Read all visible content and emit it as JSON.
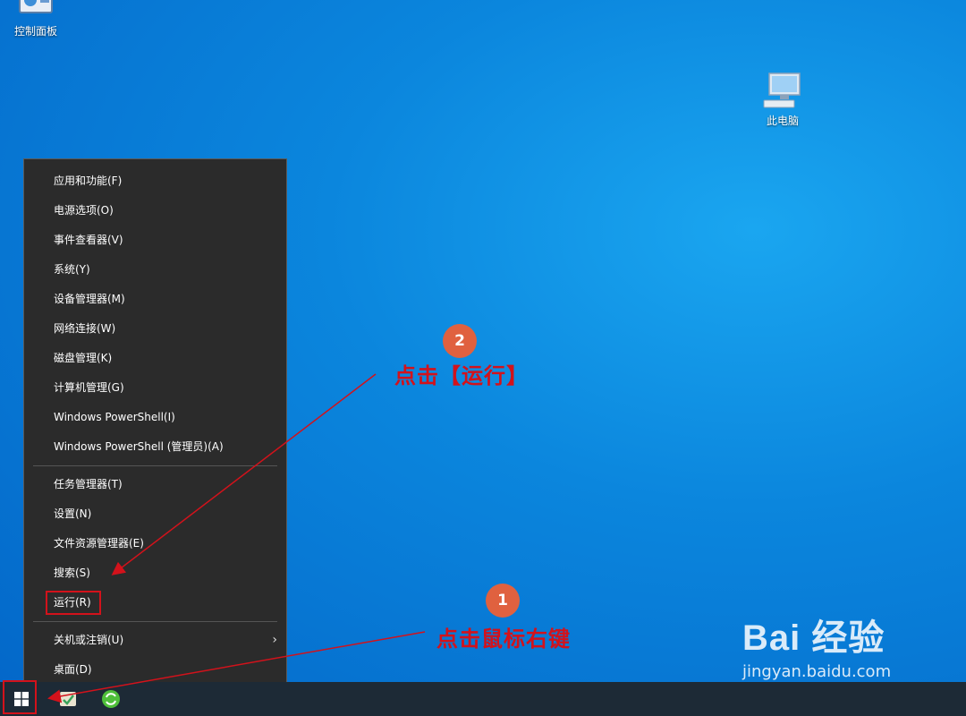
{
  "desktop": {
    "icons": [
      {
        "label": "控制面板"
      },
      {
        "label": "此电脑"
      }
    ]
  },
  "context_menu": {
    "items": [
      {
        "label": "应用和功能(F)"
      },
      {
        "label": "电源选项(O)"
      },
      {
        "label": "事件查看器(V)"
      },
      {
        "label": "系统(Y)"
      },
      {
        "label": "设备管理器(M)"
      },
      {
        "label": "网络连接(W)"
      },
      {
        "label": "磁盘管理(K)"
      },
      {
        "label": "计算机管理(G)"
      },
      {
        "label": "Windows PowerShell(I)"
      },
      {
        "label": "Windows PowerShell (管理员)(A)"
      },
      {
        "label": "任务管理器(T)"
      },
      {
        "label": "设置(N)"
      },
      {
        "label": "文件资源管理器(E)"
      },
      {
        "label": "搜索(S)"
      },
      {
        "label": "运行(R)"
      },
      {
        "label": "关机或注销(U)"
      },
      {
        "label": "桌面(D)"
      }
    ]
  },
  "annotations": {
    "step1": {
      "number": "1",
      "text": "点击鼠标右键"
    },
    "step2": {
      "number": "2",
      "text": "点击【运行】"
    }
  },
  "watermark": {
    "logo": "Bai  经验",
    "url": "jingyan.baidu.com"
  },
  "colors": {
    "annotation_red": "#d3121b",
    "badge_orange": "#e0613f",
    "menu_bg": "#2b2b2b",
    "taskbar_bg": "#1d2a36"
  }
}
